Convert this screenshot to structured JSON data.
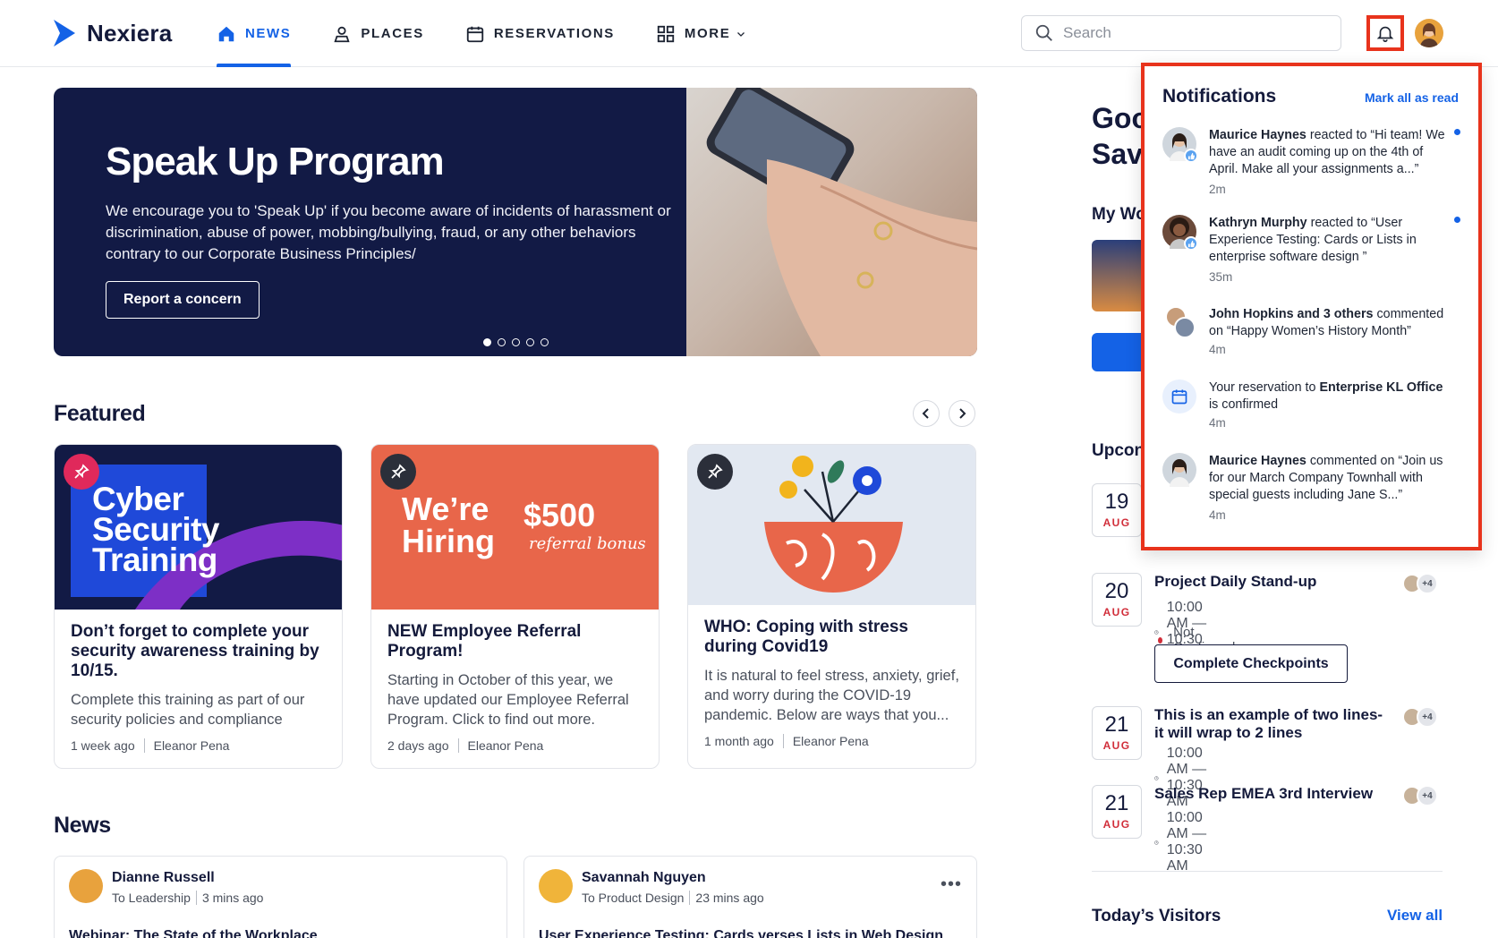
{
  "app": {
    "name": "Nexiera"
  },
  "nav": {
    "items": [
      {
        "label": "NEWS",
        "icon": "home-icon",
        "active": true
      },
      {
        "label": "PLACES",
        "icon": "place-person-icon",
        "active": false
      },
      {
        "label": "RESERVATIONS",
        "icon": "calendar-icon",
        "active": false
      },
      {
        "label": "MORE",
        "icon": "grid-icon",
        "active": false
      }
    ]
  },
  "search": {
    "placeholder": "Search"
  },
  "hero": {
    "title": "Speak Up Program",
    "description": "We encourage you to 'Speak Up' if you become aware of incidents of harassment or discrimination, abuse of power, mobbing/bullying, fraud, or any other behaviors contrary to our Corporate Business Principles/",
    "button": "Report a concern",
    "slides": 5,
    "active_slide": 1
  },
  "featured": {
    "title": "Featured",
    "cards": [
      {
        "image_text": [
          "Cyber",
          "Security",
          "Training"
        ],
        "title": "Don’t forget to complete your security awareness training by 10/15.",
        "desc": "Complete this training as part of our security policies and compliance",
        "time": "1 week ago",
        "author": "Eleanor Pena"
      },
      {
        "image_text": [
          "We’re",
          "Hiring",
          "$500",
          "referral bonus"
        ],
        "title": "NEW Employee Referral Program!",
        "desc": "Starting in October of this year, we have updated our Employee Referral Program. Click to find out more.",
        "time": "2 days ago",
        "author": "Eleanor Pena"
      },
      {
        "title": "WHO: Coping with stress during Covid19",
        "desc": "It is natural to feel stress, anxiety, grief, and worry during the COVID-19 pandemic. Below are ways that you...",
        "time": "1 month ago",
        "author": "Eleanor Pena"
      }
    ]
  },
  "news": {
    "title": "News",
    "posts": [
      {
        "author": "Dianne Russell",
        "audience": "To Leadership",
        "time": "3 mins ago",
        "title": "Webinar: The State of the Workplace"
      },
      {
        "author": "Savannah Nguyen",
        "audience": "To Product Design",
        "time": "23 mins ago",
        "title": "User Experience Testing: Cards verses Lists in Web Design",
        "more": "•••"
      }
    ]
  },
  "right": {
    "greeting_lines": [
      "Goo",
      "Sav"
    ],
    "workspace_label": "My Wo",
    "upcoming_label": "Upcon",
    "events": [
      {
        "day": "19",
        "month": "AUG"
      },
      {
        "day": "20",
        "month": "AUG",
        "title": "Project Daily Stand-up",
        "time": "10:00 AM — 10:30 AM",
        "status": "Not Confirmed",
        "button": "Complete Checkpoints",
        "more": "+4"
      },
      {
        "day": "21",
        "month": "AUG",
        "title": "This is an example of two lines- it will wrap to 2 lines",
        "time": "10:00 AM — 10:30 AM",
        "more": "+4"
      },
      {
        "day": "21",
        "month": "AUG",
        "title": "Sales Rep EMEA 3rd Interview",
        "time": "10:00 AM — 10:30 AM",
        "more": "+4"
      }
    ],
    "visitors": {
      "title": "Today’s Visitors",
      "link": "View all"
    }
  },
  "notifications": {
    "title": "Notifications",
    "mark_all": "Mark all as read",
    "items": [
      {
        "actor": "Maurice Haynes",
        "text": " reacted to “Hi team! We have an audit coming up on the 4th of April. Make all your assignments a...”",
        "time": "2m",
        "unread": true
      },
      {
        "actor": "Kathryn Murphy",
        "text": " reacted to “User Experience Testing: Cards or Lists in enterprise software design ”",
        "time": "35m",
        "unread": true
      },
      {
        "actor": "John Hopkins and 3 others",
        "text": " commented on “Happy Women’s History Month”",
        "time": "4m",
        "unread": false
      },
      {
        "prefix": "Your reservation to ",
        "actor": "Enterprise KL Office",
        "text": " is confirmed",
        "time": "4m",
        "unread": false
      },
      {
        "actor": "Maurice Haynes",
        "text": " commented on “Join us for our March Company Townhall with special guests including Jane S...”",
        "time": "4m",
        "unread": false
      }
    ]
  },
  "colors": {
    "accent": "#1462e6",
    "hero_bg": "#121a45",
    "highlight": "#e8331c",
    "date_month": "#d12e3a"
  }
}
